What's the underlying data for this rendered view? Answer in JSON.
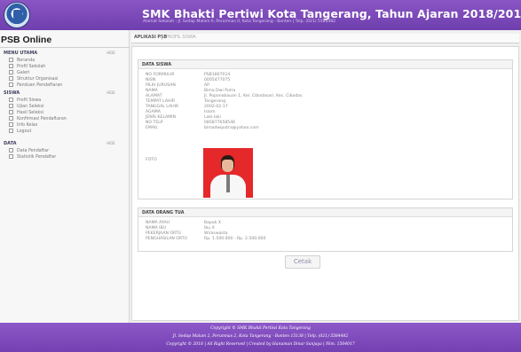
{
  "header": {
    "title": "SMK Bhakti Pertiwi Kota Tangerang, Tahun Ajaran 2018/2019",
    "address": "Alamat Sekolah : Jl. Sedap Malam II, Perumnas II, Kota Tangerang - Banten | Telp. (021) 5584482"
  },
  "sidebar": {
    "brand": "PSB Online",
    "hide_label": "HIDE",
    "sections": [
      {
        "title": "MENU UTAMA",
        "items": [
          "Beranda",
          "Profil Sekolah",
          "Galeri",
          "Struktur Organisasi",
          "Panduan Pendaftaran"
        ]
      },
      {
        "title": "SISWA",
        "items": [
          "Profil Siswa",
          "Ujian Seleksi",
          "Hasil Seleksi",
          "Konfirmasi Pendaftaran",
          "Info Kelas",
          "Logout"
        ]
      },
      {
        "title": "DATA",
        "items": [
          "Data Pendaftar",
          "Statistik Pendaftar"
        ]
      }
    ]
  },
  "tabs": {
    "main": "APLIKASI PSB",
    "sub": "PROFIL SISWA"
  },
  "student": {
    "title": "DATA SISWA",
    "fields": [
      {
        "label": "NO FORMULIR",
        "value": "PSB1807014"
      },
      {
        "label": "NISN",
        "value": "0005477075"
      },
      {
        "label": "PILIH JURUSAN",
        "value": "AP"
      },
      {
        "label": "NAMA",
        "value": "Bima Dwi Putra"
      },
      {
        "label": "ALAMAT",
        "value": "Jl. Poponobauan 1, Kel. Cibodasari, Kec. Cibodas"
      },
      {
        "label": "TEMPAT LAHIR",
        "value": "Tangerang"
      },
      {
        "label": "TANGGAL LAHIR",
        "value": "2002-02-17"
      },
      {
        "label": "AGAMA",
        "value": "Islam"
      },
      {
        "label": "JENIS KELAMIN",
        "value": "Laki-laki"
      },
      {
        "label": "NO TELP",
        "value": "085877658546"
      },
      {
        "label": "EMAIL",
        "value": "bimadwiputra@yahoo.com"
      }
    ],
    "photo_label": "FOTO"
  },
  "parents": {
    "title": "DATA ORANG TUA",
    "fields": [
      {
        "label": "NAMA AYAH",
        "value": "Bapak X"
      },
      {
        "label": "NAMA IBU",
        "value": "Ibu X"
      },
      {
        "label": "PEKERJAAN ORTU",
        "value": "Wiraswasta"
      },
      {
        "label": "PENGHASILAN ORTU",
        "value": "Rp. 1.500.000 - Rp. 2.500.000"
      }
    ]
  },
  "buttons": {
    "print": "Cetak"
  },
  "footer": {
    "line1": "Copyright © SMK Bhakti Pertiwi Kota Tangerang",
    "line2": "Jl. Sedap Malam 2, Perumnas 2, Kota Tangerang - Banten 15138 | Telp. (021) 5584482",
    "line3": "Copyright © 2018 | All Right Reserved | Created by Hanuman Dinar Sanjaya | Nim. 1504017"
  }
}
